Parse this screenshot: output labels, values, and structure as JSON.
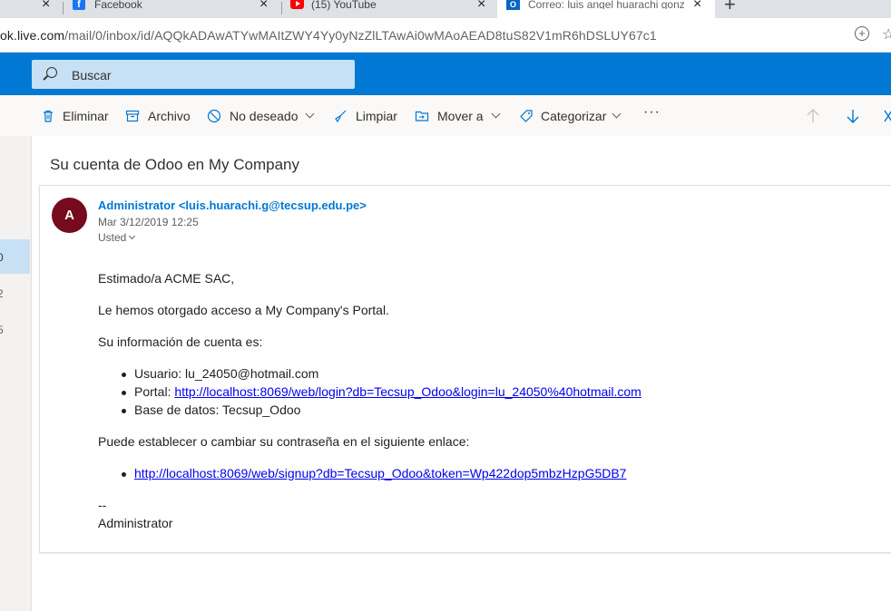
{
  "browser": {
    "tabs": [
      {
        "title": "Facebook",
        "active": false
      },
      {
        "title": "(15) YouTube",
        "active": false
      },
      {
        "title": "Correo: luis angel huarachi gonz",
        "active": true
      }
    ],
    "url_prefix": "ok.live.com",
    "url_path": "/mail/0/inbox/id/AQQkADAwATYwMAItZWY4Yy0yNzZlLTAwAi0wMAoAEAD8tuS82V1mR6hDSLUY67c1"
  },
  "outlook": {
    "search_placeholder": "Buscar",
    "commands": [
      {
        "label": "Eliminar",
        "icon": "trash-icon"
      },
      {
        "label": "Archivo",
        "icon": "archive-icon"
      },
      {
        "label": "No deseado",
        "icon": "block-icon"
      },
      {
        "label": "Limpiar",
        "icon": "broom-icon"
      },
      {
        "label": "Mover a",
        "icon": "move-folder-icon"
      },
      {
        "label": "Categorizar",
        "icon": "tag-icon"
      },
      {
        "label": "···",
        "icon": "more-icon"
      }
    ],
    "folder_counts": [
      "0",
      "2",
      "5"
    ]
  },
  "message": {
    "subject": "Su cuenta de Odoo en My Company",
    "avatar_initial": "A",
    "avatar_color": "#750b1c",
    "sender": "Administrator <luis.huarachi.g@tecsup.edu.pe>",
    "date": "Mar 3/12/2019 12:25",
    "to": "Usted",
    "greeting": "Estimado/a ACME SAC,",
    "line1": "Le hemos otorgado acceso a My Company's Portal.",
    "line2": "Su información de cuenta es:",
    "user_label": "Usuario: lu_24050@hotmail.com",
    "portal_label": "Portal: ",
    "portal_link": "http://localhost:8069/web/login?db=Tecsup_Odoo&login=lu_24050%40hotmail.com",
    "db_label": "Base de datos: Tecsup_Odoo",
    "line3": "Puede establecer o cambiar su contraseña en el siguiente enlace:",
    "signup_link": "http://localhost:8069/web/signup?db=Tecsup_Odoo&token=Wp422dop5mbzHzpG5DB7",
    "sig_dash": "--",
    "signature": "Administrator"
  }
}
